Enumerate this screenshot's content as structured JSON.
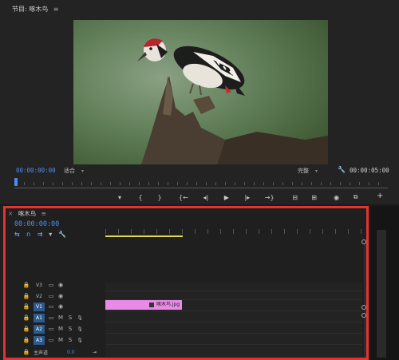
{
  "program": {
    "title": "节目: 啄木鸟",
    "menu_icon": "≡",
    "timecode_current": "00:00:00:00",
    "fit_value": "适合",
    "resolution_value": "完整",
    "timecode_duration": "00:00:05:00",
    "transport_icons": [
      "marker-icon",
      "mark-in-icon",
      "mark-out-icon",
      "go-to-in-icon",
      "step-back-icon",
      "play-icon",
      "step-forward-icon",
      "go-to-out-icon",
      "lift-icon",
      "extract-icon",
      "export-frame-icon",
      "compare-icon"
    ],
    "transport_glyphs": [
      "▾",
      "{",
      "}",
      "{←",
      "◂|",
      "▶",
      "|▸",
      "→}",
      "⊟",
      "⊞",
      "◉",
      "⧉"
    ],
    "add_glyph": "+",
    "wrench_glyph": "🔧"
  },
  "timeline": {
    "close_glyph": "×",
    "title": "啄木鸟",
    "menu_icon": "≡",
    "timecode": "00:00:00:00",
    "tools": [
      "⇆",
      "∩",
      "⇉",
      "▾",
      "🔧"
    ],
    "tracks": [
      {
        "name": "V3",
        "active": false,
        "type": "video"
      },
      {
        "name": "V2",
        "active": false,
        "type": "video"
      },
      {
        "name": "V1",
        "active": true,
        "type": "video"
      },
      {
        "name": "A1",
        "active": true,
        "type": "audio"
      },
      {
        "name": "A2",
        "active": true,
        "type": "audio"
      },
      {
        "name": "A3",
        "active": true,
        "type": "audio"
      }
    ],
    "master_label": "主声道",
    "master_value": "0.0",
    "clip_name": "啄木鸟.jpg",
    "m_label": "M",
    "s_label": "S"
  },
  "colors": {
    "accent_blue": "#4b8df0",
    "highlight_red": "#e4332f",
    "clip_pink": "#e88be6",
    "work_area_yellow": "#e2d84a"
  }
}
